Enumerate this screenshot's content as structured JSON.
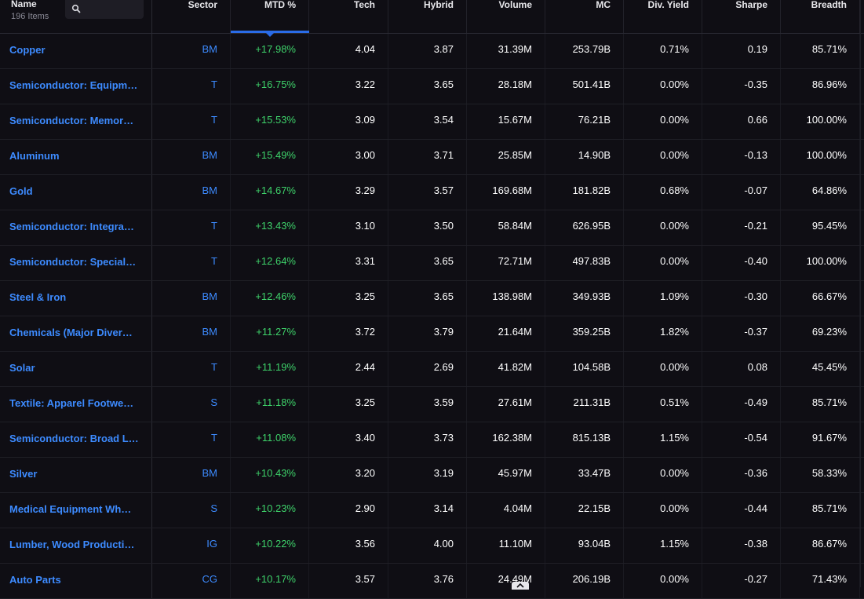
{
  "header": {
    "name_label": "Name",
    "item_count": "196 Items",
    "search_icon": "search-icon",
    "columns": [
      "Sector",
      "MTD %",
      "Tech",
      "Hybrid",
      "Volume",
      "MC",
      "Div. Yield",
      "Sharpe",
      "Breadth"
    ],
    "sorted_column": "MTD %",
    "accent_color": "#2a6ce8"
  },
  "colors": {
    "name_link": "#3d8bff",
    "positive": "#3ed26a",
    "background": "#0f0e14"
  },
  "rows": [
    {
      "name": "Copper",
      "sector": "BM",
      "mtd": "+17.98%",
      "tech": "4.04",
      "hybrid": "3.87",
      "volume": "31.39M",
      "mc": "253.79B",
      "div": "0.71%",
      "sharpe": "0.19",
      "breadth": "85.71%"
    },
    {
      "name": "Semiconductor: Equipm…",
      "sector": "T",
      "mtd": "+16.75%",
      "tech": "3.22",
      "hybrid": "3.65",
      "volume": "28.18M",
      "mc": "501.41B",
      "div": "0.00%",
      "sharpe": "-0.35",
      "breadth": "86.96%"
    },
    {
      "name": "Semiconductor: Memor…",
      "sector": "T",
      "mtd": "+15.53%",
      "tech": "3.09",
      "hybrid": "3.54",
      "volume": "15.67M",
      "mc": "76.21B",
      "div": "0.00%",
      "sharpe": "0.66",
      "breadth": "100.00%"
    },
    {
      "name": "Aluminum",
      "sector": "BM",
      "mtd": "+15.49%",
      "tech": "3.00",
      "hybrid": "3.71",
      "volume": "25.85M",
      "mc": "14.90B",
      "div": "0.00%",
      "sharpe": "-0.13",
      "breadth": "100.00%"
    },
    {
      "name": "Gold",
      "sector": "BM",
      "mtd": "+14.67%",
      "tech": "3.29",
      "hybrid": "3.57",
      "volume": "169.68M",
      "mc": "181.82B",
      "div": "0.68%",
      "sharpe": "-0.07",
      "breadth": "64.86%"
    },
    {
      "name": "Semiconductor: Integra…",
      "sector": "T",
      "mtd": "+13.43%",
      "tech": "3.10",
      "hybrid": "3.50",
      "volume": "58.84M",
      "mc": "626.95B",
      "div": "0.00%",
      "sharpe": "-0.21",
      "breadth": "95.45%"
    },
    {
      "name": "Semiconductor: Special…",
      "sector": "T",
      "mtd": "+12.64%",
      "tech": "3.31",
      "hybrid": "3.65",
      "volume": "72.71M",
      "mc": "497.83B",
      "div": "0.00%",
      "sharpe": "-0.40",
      "breadth": "100.00%"
    },
    {
      "name": "Steel & Iron",
      "sector": "BM",
      "mtd": "+12.46%",
      "tech": "3.25",
      "hybrid": "3.65",
      "volume": "138.98M",
      "mc": "349.93B",
      "div": "1.09%",
      "sharpe": "-0.30",
      "breadth": "66.67%"
    },
    {
      "name": "Chemicals (Major Diver…",
      "sector": "BM",
      "mtd": "+11.27%",
      "tech": "3.72",
      "hybrid": "3.79",
      "volume": "21.64M",
      "mc": "359.25B",
      "div": "1.82%",
      "sharpe": "-0.37",
      "breadth": "69.23%"
    },
    {
      "name": "Solar",
      "sector": "T",
      "mtd": "+11.19%",
      "tech": "2.44",
      "hybrid": "2.69",
      "volume": "41.82M",
      "mc": "104.58B",
      "div": "0.00%",
      "sharpe": "0.08",
      "breadth": "45.45%"
    },
    {
      "name": "Textile: Apparel Footwe…",
      "sector": "S",
      "mtd": "+11.18%",
      "tech": "3.25",
      "hybrid": "3.59",
      "volume": "27.61M",
      "mc": "211.31B",
      "div": "0.51%",
      "sharpe": "-0.49",
      "breadth": "85.71%"
    },
    {
      "name": "Semiconductor: Broad L…",
      "sector": "T",
      "mtd": "+11.08%",
      "tech": "3.40",
      "hybrid": "3.73",
      "volume": "162.38M",
      "mc": "815.13B",
      "div": "1.15%",
      "sharpe": "-0.54",
      "breadth": "91.67%"
    },
    {
      "name": "Silver",
      "sector": "BM",
      "mtd": "+10.43%",
      "tech": "3.20",
      "hybrid": "3.19",
      "volume": "45.97M",
      "mc": "33.47B",
      "div": "0.00%",
      "sharpe": "-0.36",
      "breadth": "58.33%"
    },
    {
      "name": "Medical Equipment Wh…",
      "sector": "S",
      "mtd": "+10.23%",
      "tech": "2.90",
      "hybrid": "3.14",
      "volume": "4.04M",
      "mc": "22.15B",
      "div": "0.00%",
      "sharpe": "-0.44",
      "breadth": "85.71%"
    },
    {
      "name": "Lumber, Wood Producti…",
      "sector": "IG",
      "mtd": "+10.22%",
      "tech": "3.56",
      "hybrid": "4.00",
      "volume": "11.10M",
      "mc": "93.04B",
      "div": "1.15%",
      "sharpe": "-0.38",
      "breadth": "86.67%"
    },
    {
      "name": "Auto Parts",
      "sector": "CG",
      "mtd": "+10.17%",
      "tech": "3.57",
      "hybrid": "3.76",
      "volume": "24.49M",
      "mc": "206.19B",
      "div": "0.00%",
      "sharpe": "-0.27",
      "breadth": "71.43%"
    }
  ]
}
